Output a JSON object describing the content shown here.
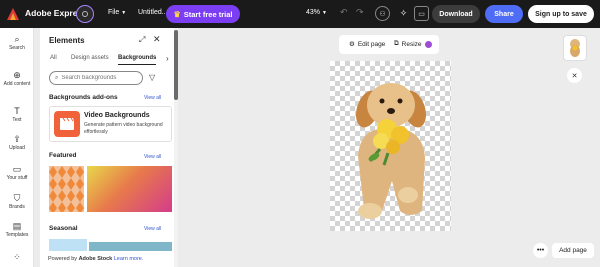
{
  "topbar": {
    "brand": "Adobe Express",
    "file_label": "File",
    "doc_title": "Untitled...",
    "trial_label": "Start free trial",
    "zoom_label": "43%",
    "download_label": "Download",
    "share_label": "Share",
    "signup_label": "Sign up to save",
    "colors": {
      "background": "#1a1a1a",
      "trial": "#7b3ef2",
      "share": "#4f6cf7"
    }
  },
  "rail": {
    "items": [
      {
        "label": "Search",
        "icon": "search-icon"
      },
      {
        "label": "Add content",
        "icon": "plus-icon"
      },
      {
        "label": "Text",
        "icon": "text-icon"
      },
      {
        "label": "Upload",
        "icon": "upload-icon"
      },
      {
        "label": "Your stuff",
        "icon": "folder-icon"
      },
      {
        "label": "Brands",
        "icon": "brand-icon"
      },
      {
        "label": "Templates",
        "icon": "templates-icon"
      }
    ]
  },
  "panel": {
    "title": "Elements",
    "tabs": [
      "All",
      "Design assets",
      "Backgrounds"
    ],
    "active_tab": "Backgrounds",
    "search_placeholder": "Search backgrounds",
    "sections": {
      "addons": {
        "title": "Backgrounds add-ons",
        "view_all": "View all"
      },
      "featured": {
        "title": "Featured",
        "view_all": "View all"
      },
      "seasonal": {
        "title": "Seasonal",
        "view_all": "View all"
      }
    },
    "addon_card": {
      "name": "Video Backgrounds",
      "description": "Generate pattern video background effortlessly"
    },
    "powered_prefix": "Powered by ",
    "powered_brand": "Adobe Stock",
    "powered_link": "Learn more."
  },
  "canvas": {
    "edit_page_label": "Edit page",
    "resize_label": "Resize",
    "add_page_label": "Add page"
  }
}
